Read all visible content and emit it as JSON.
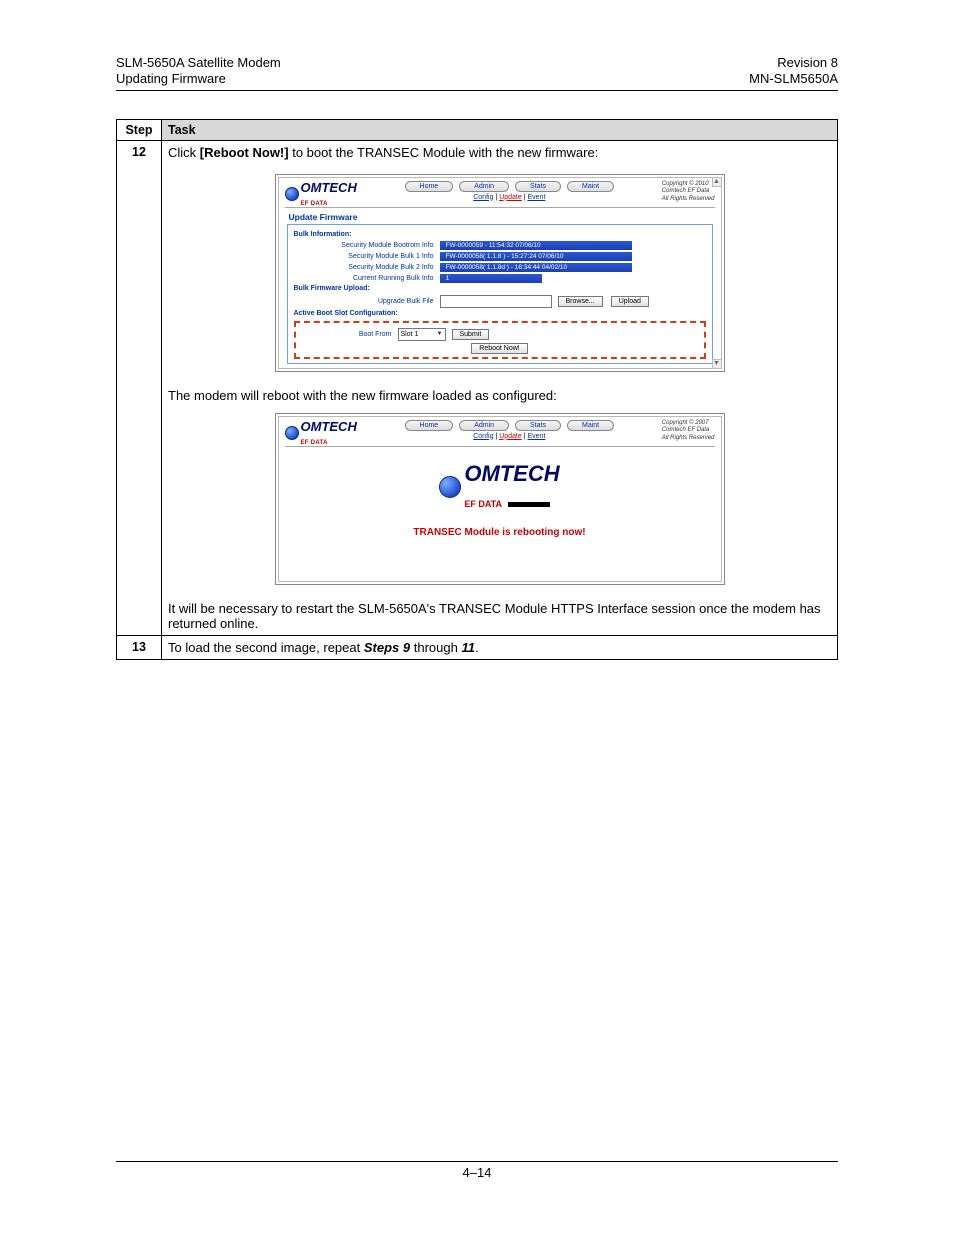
{
  "header": {
    "left_line1": "SLM-5650A Satellite Modem",
    "left_line2": "Updating Firmware",
    "right_line1": "Revision 8",
    "right_line2": "MN-SLM5650A"
  },
  "table": {
    "col_step": "Step",
    "col_task": "Task",
    "row12": {
      "num": "12",
      "line1_pre": "Click ",
      "line1_bold": "[Reboot Now!]",
      "line1_post": " to boot the TRANSEC Module with the new firmware:",
      "line2": "The modem will reboot with the new firmware loaded as configured:",
      "line3": "It will be necessary to restart the SLM-5650A's TRANSEC Module HTTPS Interface session once the modem has returned online."
    },
    "row13": {
      "num": "13",
      "pre": "To load the second image, repeat ",
      "bold": "Steps 9",
      "mid": " through ",
      "bold2": "11",
      "post": "."
    }
  },
  "shot1": {
    "logo_main": "OMTECH",
    "logo_sub": "EF DATA",
    "nav": {
      "home": "Home",
      "admin": "Admin",
      "stats": "Stats",
      "maint": "Maint"
    },
    "subnav": {
      "config": "Config",
      "update": "Update",
      "event": "Event",
      "sep": " | "
    },
    "copyright": "Copyright © 2010\nComtech EF Data\nAll Rights Reserved",
    "title": "Update Firmware",
    "sect_bulk": "Bulk Information:",
    "rows": {
      "bootrom_lbl": "Security Module Bootrom Info",
      "bootrom_val": "FW-0000059 - 11:54:32 07/06/10",
      "bulk1_lbl": "Security Module Bulk 1 Info",
      "bulk1_val": "FW-0000058( 1.1.8 ) - 15:27:24 07/06/10",
      "bulk2_lbl": "Security Module Bulk 2 Info",
      "bulk2_val": "FW-0000058( 1.1.8d ) - 16:34:44 04/02/10",
      "running_lbl": "Current Running Bulk Info",
      "running_val": "1"
    },
    "sect_upload": "Bulk Firmware Upload:",
    "upload_lbl": "Upgrade Bulk File",
    "browse": "Browse...",
    "upload": "Upload",
    "sect_boot": "Active Boot Slot Configuration:",
    "bootfrom_lbl": "Boot From",
    "slot_val": "Slot 1",
    "submit": "Submit",
    "reboot": "Reboot Now!"
  },
  "shot2": {
    "logo_main": "OMTECH",
    "logo_sub": "EF DATA",
    "nav": {
      "home": "Home",
      "admin": "Admin",
      "stats": "Stats",
      "maint": "Maint"
    },
    "subnav": {
      "config": "Config",
      "update": "Update",
      "event": "Event",
      "sep": " | "
    },
    "copyright": "Copyright © 2007\nComtech EF Data\nAll Rights Reserved",
    "reboot_msg": "TRANSEC Module is rebooting now!"
  },
  "footer": "4–14"
}
